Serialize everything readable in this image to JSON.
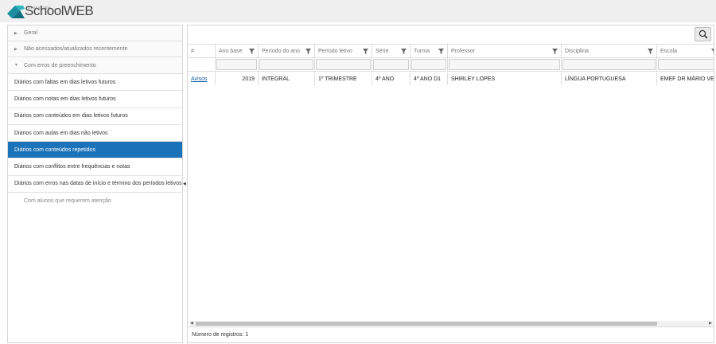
{
  "header": {
    "logo_small": "TOTVSYSTEM",
    "logo_text": "SchoolWEB"
  },
  "sidebar": {
    "groups": [
      {
        "label": "Geral",
        "expanded": false
      },
      {
        "label": "Não acessados/atualizados recentemente",
        "expanded": false
      },
      {
        "label": "Com erros de preenchimento",
        "expanded": true
      }
    ],
    "items": [
      {
        "label": "Diários com faltas em dias letivos futuros",
        "selected": false
      },
      {
        "label": "Diários com notas em dias letivos futuros",
        "selected": false
      },
      {
        "label": "Diários com conteúdos em dias letivos futuros",
        "selected": false
      },
      {
        "label": "Diários com aulas em dias não letivos",
        "selected": false
      },
      {
        "label": "Diários com conteúdos repetidos",
        "selected": true
      },
      {
        "label": "Diários com conflitos entre frequências e notas",
        "selected": false
      },
      {
        "label": "Diários com erros nas datas de início e término dos períodos letivos",
        "selected": false
      }
    ],
    "sub_group": "Com alunos que requerem atenção",
    "selected_color": "#1a72b9"
  },
  "table": {
    "columns": [
      "#",
      "Ano base",
      "Período do ano",
      "Período letivo",
      "Série",
      "Turma",
      "Professor",
      "Disciplina",
      "Escola"
    ],
    "rows": [
      [
        "Avisos",
        "2019",
        "INTEGRAL",
        "1º TRIMESTRE",
        "4º ANO",
        "4º ANO D1",
        "SHIRLEY LOPES",
        "LÍNGUA PORTUGUESA",
        "EMEF DR MÁRIO VELLI"
      ]
    ]
  },
  "footer": {
    "record_count": "Número de registros: 1"
  }
}
